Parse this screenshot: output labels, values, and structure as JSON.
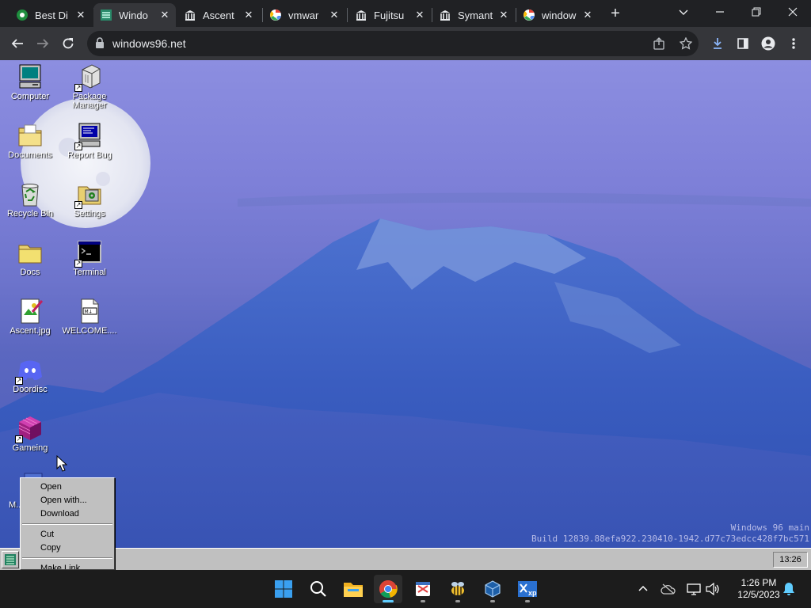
{
  "browser": {
    "tabs": [
      {
        "title": "Best Di",
        "favicon": "app-icon",
        "active": false
      },
      {
        "title": "Windo",
        "favicon": "windows96-icon",
        "active": true
      },
      {
        "title": "Ascent",
        "favicon": "archive-icon",
        "active": false
      },
      {
        "title": "vmwar",
        "favicon": "google-icon",
        "active": false
      },
      {
        "title": "Fujitsu",
        "favicon": "archive-icon",
        "active": false
      },
      {
        "title": "Symant",
        "favicon": "archive-icon",
        "active": false
      },
      {
        "title": "window",
        "favicon": "google-icon",
        "active": false
      }
    ],
    "url": "windows96.net"
  },
  "desktop": {
    "icons": [
      {
        "label": "Computer",
        "icon": "computer-icon"
      },
      {
        "label": "Package Manager",
        "icon": "package-icon"
      },
      {
        "label": "Documents",
        "icon": "folder-icon"
      },
      {
        "label": "Report Bug",
        "icon": "monitor-icon"
      },
      {
        "label": "Recycle Bin",
        "icon": "recycle-bin-icon"
      },
      {
        "label": "Settings",
        "icon": "settings-icon"
      },
      {
        "label": "Docs",
        "icon": "folder-icon"
      },
      {
        "label": "Terminal",
        "icon": "terminal-icon"
      },
      {
        "label": "Ascent.jpg",
        "icon": "image-file-icon"
      },
      {
        "label": "WELCOME....",
        "icon": "markdown-file-icon"
      },
      {
        "label": "Doordisc",
        "icon": "discord-icon"
      },
      {
        "label": "Gameing",
        "icon": "cube-icon"
      },
      {
        "label": "M...",
        "icon": "file-icon"
      }
    ],
    "build_info": {
      "line1": "Windows 96 main",
      "line2": "Build 12839.88efa922.230410-1942.d77c73edcc428f7bc571"
    },
    "context_menu": {
      "group1": [
        "Open",
        "Open with...",
        "Download"
      ],
      "group2": [
        "Cut",
        "Copy"
      ],
      "group3": [
        "Make Link"
      ]
    }
  },
  "w96_taskbar": {
    "clock": "13:26"
  },
  "win_taskbar": {
    "apps": [
      "start-icon",
      "search-icon",
      "file-explorer-icon",
      "chrome-icon",
      "snipping-tool-icon",
      "bee-app-icon",
      "virtualbox-icon",
      "windows-xp-vm-icon"
    ],
    "time": "1:26 PM",
    "date": "12/5/2023"
  },
  "colors": {
    "accent": "#60cdff",
    "chrome_dark": "#202124",
    "win96_gray": "#c0c0c0"
  }
}
